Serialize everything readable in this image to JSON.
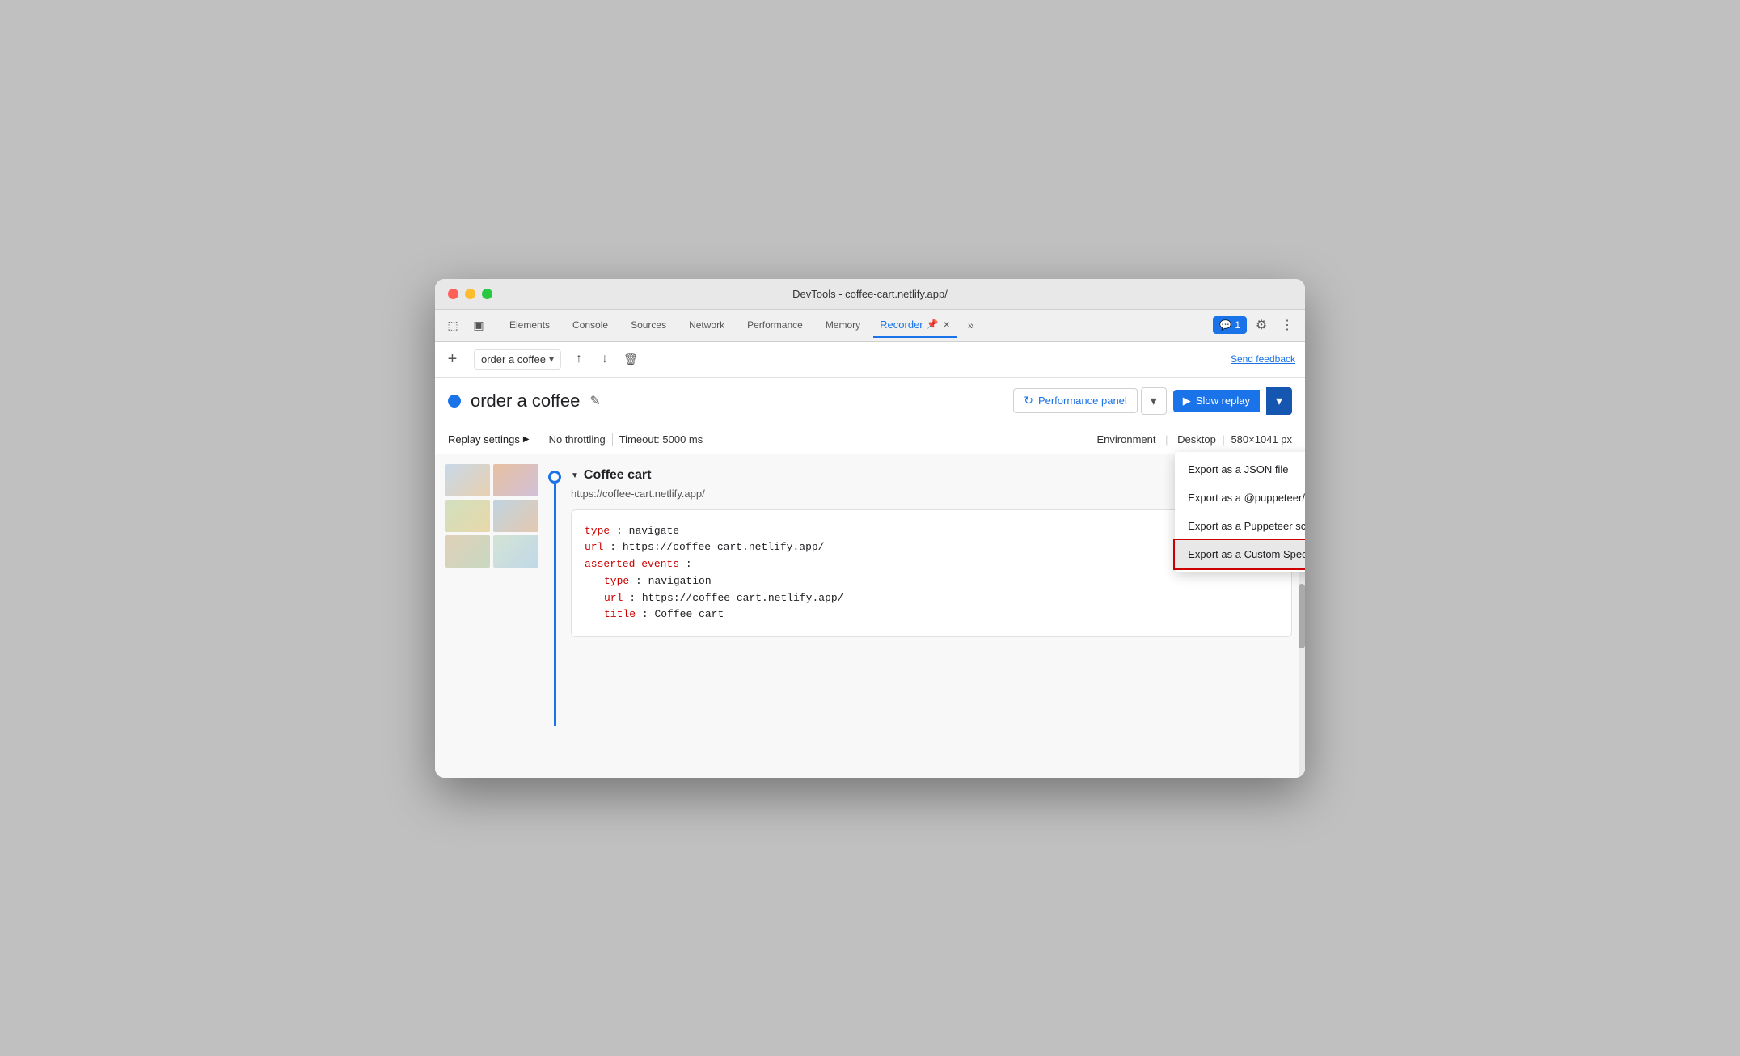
{
  "window": {
    "title": "DevTools - coffee-cart.netlify.app/"
  },
  "traffic_lights": {
    "red": "#ff5f57",
    "yellow": "#febc2e",
    "green": "#28c840"
  },
  "tabs": [
    {
      "label": "Elements",
      "active": false
    },
    {
      "label": "Console",
      "active": false
    },
    {
      "label": "Sources",
      "active": false
    },
    {
      "label": "Network",
      "active": false
    },
    {
      "label": "Performance",
      "active": false
    },
    {
      "label": "Memory",
      "active": false
    },
    {
      "label": "Recorder",
      "active": true
    }
  ],
  "recorder_tab": {
    "label": "Recorder",
    "pin_icon": "📌",
    "close_icon": "×"
  },
  "tab_bar_right": {
    "feedback_badge": "1",
    "settings_icon": "⚙",
    "more_icon": "⋮"
  },
  "toolbar": {
    "add_icon": "+",
    "recording_name": "order a coffee",
    "chevron_icon": "▾",
    "upload_icon": "↑",
    "download_icon": "↓",
    "delete_icon": "🗑",
    "send_feedback": "Send feedback"
  },
  "recording_header": {
    "dot_color": "#1a73e8",
    "title": "order a coffee",
    "edit_icon": "✎",
    "performance_panel_label": "Performance panel",
    "refresh_icon": "↻",
    "slow_replay_label": "Slow replay",
    "play_icon": "▶"
  },
  "export_dropdown": {
    "items": [
      {
        "label": "Export as a JSON file",
        "highlighted": false
      },
      {
        "label": "Export as a @puppeteer/replay script",
        "highlighted": false
      },
      {
        "label": "Export as a Puppeteer script",
        "highlighted": false
      },
      {
        "label": "Export as a Custom Special script",
        "highlighted": true
      }
    ]
  },
  "settings_bar": {
    "label": "Replay settings",
    "triangle": "▶",
    "throttling": "No throttling",
    "timeout": "Timeout: 5000 ms",
    "environment_label": "Environment",
    "environment_value": "Desktop",
    "environment_size": "580×1041 px"
  },
  "step": {
    "title": "Coffee cart",
    "url": "https://coffee-cart.netlify.app/",
    "more_icon": "⋮",
    "code": {
      "type_key": "type",
      "type_val": "navigate",
      "url_key": "url",
      "url_val": "https://coffee-cart.netlify.app/",
      "asserted_key": "asserted events",
      "inner_type_key": "type",
      "inner_type_val": "navigation",
      "inner_url_key": "url",
      "inner_url_val": "https://coffee-cart.netlify.app/",
      "title_key": "title",
      "title_val": "Coffee cart"
    }
  }
}
